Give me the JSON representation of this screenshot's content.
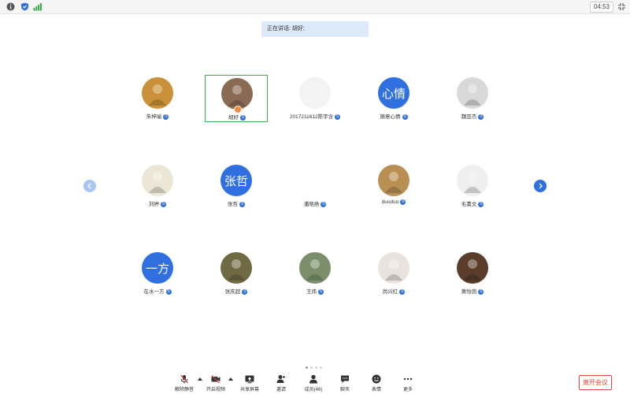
{
  "topbar": {
    "icons": [
      "info-icon",
      "shield-icon",
      "signal-icon",
      "fullscreen-exit-icon"
    ],
    "time": "04:53"
  },
  "speaking": {
    "text": "正在讲话: 胡好;"
  },
  "participants": [
    {
      "name": "朱梓瑜",
      "avatar": "photo",
      "photo_color": "#c9923a"
    },
    {
      "name": "胡好",
      "avatar": "photo",
      "photo_color": "#8a6a52",
      "selected": true,
      "host": true
    },
    {
      "name": "2017211612陈宇含",
      "avatar": "blank",
      "photo_color": "#f3f3f3"
    },
    {
      "name": "随意心情",
      "avatar": "text",
      "avatar_text": "心情"
    },
    {
      "name": "魏亚杰",
      "avatar": "photo",
      "photo_color": "#d8d8d8"
    },
    {
      "name": "刘婷",
      "avatar": "photo",
      "photo_color": "#ece6d7"
    },
    {
      "name": "张哲",
      "avatar": "text",
      "avatar_text": "张哲"
    },
    {
      "name": "潘晓扬",
      "avatar": "qrcode",
      "photo_color": "#555555"
    },
    {
      "name": "duoduo",
      "avatar": "photo",
      "photo_color": "#b98f53"
    },
    {
      "name": "毛書文",
      "avatar": "photo",
      "photo_color": "#efefef"
    },
    {
      "name": "在水一方",
      "avatar": "text",
      "avatar_text": "一方"
    },
    {
      "name": "张庆超",
      "avatar": "photo",
      "photo_color": "#6f6a44"
    },
    {
      "name": "王炜",
      "avatar": "photo",
      "photo_color": "#7c8f6b"
    },
    {
      "name": "尚兴红",
      "avatar": "photo",
      "photo_color": "#e9e2de"
    },
    {
      "name": "黄怡茵",
      "avatar": "photo",
      "photo_color": "#5a3d2a"
    }
  ],
  "badge_text": "S",
  "pagination": {
    "pages": 4,
    "current": 1
  },
  "toolbar": {
    "items": [
      {
        "label": "解除静音",
        "icon": "mic-muted-icon"
      },
      {
        "label": "开启视频",
        "icon": "video-off-icon"
      },
      {
        "label": "共享屏幕",
        "icon": "share-screen-icon"
      },
      {
        "label": "邀请",
        "icon": "invite-icon"
      },
      {
        "label": "成员(46)",
        "icon": "members-icon"
      },
      {
        "label": "聊天",
        "icon": "chat-icon"
      },
      {
        "label": "表情",
        "icon": "emoji-icon"
      },
      {
        "label": "更多",
        "icon": "more-icon"
      }
    ],
    "leave_label": "离开会议"
  },
  "colors": {
    "accent": "#2f6fdf",
    "selected_border": "#43b14b",
    "leave": "#e0453b",
    "speaking_bg": "#dce9f8"
  }
}
